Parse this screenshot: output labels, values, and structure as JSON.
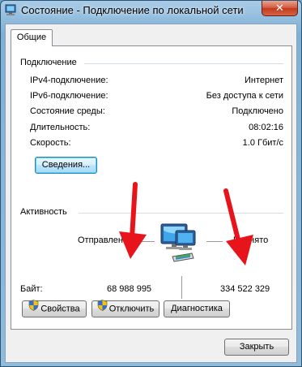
{
  "window": {
    "title": "Состояние - Подключение по локальной сети",
    "close_glyph": "✕"
  },
  "tabs": [
    {
      "label": "Общие",
      "active": true
    }
  ],
  "connection": {
    "heading": "Подключение",
    "rows": [
      {
        "label": "IPv4-подключение:",
        "value": "Интернет"
      },
      {
        "label": "IPv6-подключение:",
        "value": "Без доступа к сети"
      },
      {
        "label": "Состояние среды:",
        "value": "Подключено"
      },
      {
        "label": "Длительность:",
        "value": "08:02:16"
      },
      {
        "label": "Скорость:",
        "value": "1.0 Гбит/с"
      }
    ],
    "details_button": "Сведения..."
  },
  "activity": {
    "heading": "Активность",
    "sent_label": "Отправлено",
    "received_label": "Принято",
    "bytes_label": "Байт:",
    "bytes_sent": "68 988 995",
    "bytes_received": "334 522 329"
  },
  "buttons": {
    "properties": "Свойства",
    "disable": "Отключить",
    "diagnose": "Диагностика",
    "close": "Закрыть"
  },
  "colors": {
    "annotation_arrow": "#e8141b",
    "title_bar": "#8fbbdc",
    "close_button": "#c8432a"
  }
}
